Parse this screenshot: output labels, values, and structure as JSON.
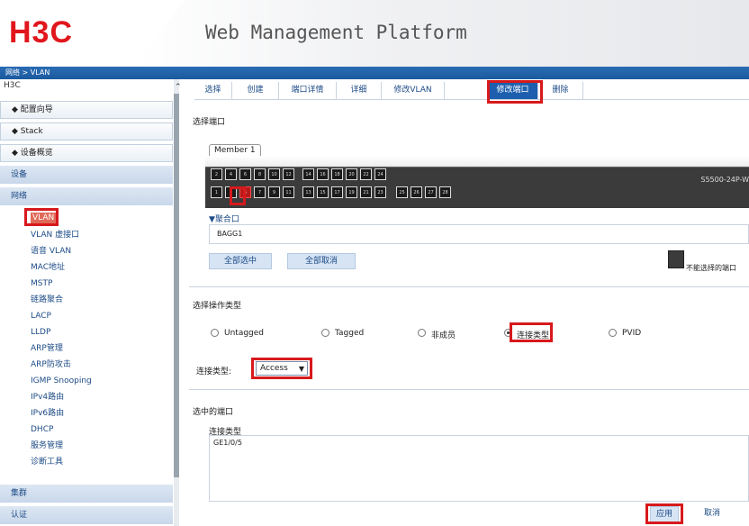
{
  "header": {
    "logo": "H3C",
    "title": "Web Management Platform"
  },
  "breadcrumb": "网络 > VLAN",
  "sidebar": {
    "root": "H3C",
    "sections": [
      "◆ 配置向导",
      "◆ Stack",
      "◆ 设备概览"
    ],
    "groups": {
      "device": "设备",
      "network": "网络",
      "cluster": "集群",
      "auth": "认证"
    },
    "items": [
      "VLAN",
      "VLAN 虚接口",
      "语音 VLAN",
      "MAC地址",
      "MSTP",
      "链路聚合",
      "LACP",
      "LLDP",
      "ARP管理",
      "ARP防攻击",
      "IGMP Snooping",
      "IPv4路由",
      "IPv6路由",
      "DHCP",
      "服务管理",
      "诊断工具"
    ]
  },
  "tabs": [
    "选择",
    "创建",
    "端口详情",
    "详细",
    "修改VLAN",
    "修改端口",
    "删除"
  ],
  "port_select": {
    "title": "选择端口",
    "member_tab": "Member 1",
    "top_ports": [
      "2",
      "4",
      "6",
      "8",
      "10",
      "12",
      "14",
      "16",
      "18",
      "20",
      "22",
      "24"
    ],
    "bottom_ports": [
      "1",
      "3",
      "5",
      "7",
      "9",
      "11",
      "13",
      "15",
      "17",
      "19",
      "21",
      "23"
    ],
    "extra_ports": [
      "25",
      "26",
      "27",
      "28"
    ],
    "selected_port": "5",
    "model": "S5500-24P-W",
    "agg_title": "▼聚合口",
    "agg_value": "BAGG1",
    "select_all": "全部选中",
    "deselect_all": "全部取消",
    "legend": "不能选择的端口"
  },
  "op_type": {
    "title": "选择操作类型",
    "options": [
      "Untagged",
      "Tagged",
      "非成员",
      "连接类型",
      "PVID"
    ],
    "selected": "连接类型"
  },
  "link_type": {
    "label": "连接类型:",
    "value": "Access"
  },
  "selected_ports": {
    "title": "选中的端口",
    "column": "连接类型",
    "value": "GE1/0/5"
  },
  "actions": {
    "apply": "应用",
    "cancel": "取消"
  },
  "colors": {
    "accent": "#1d5fae",
    "highlight": "#d7191c",
    "logo": "#e1161d"
  }
}
